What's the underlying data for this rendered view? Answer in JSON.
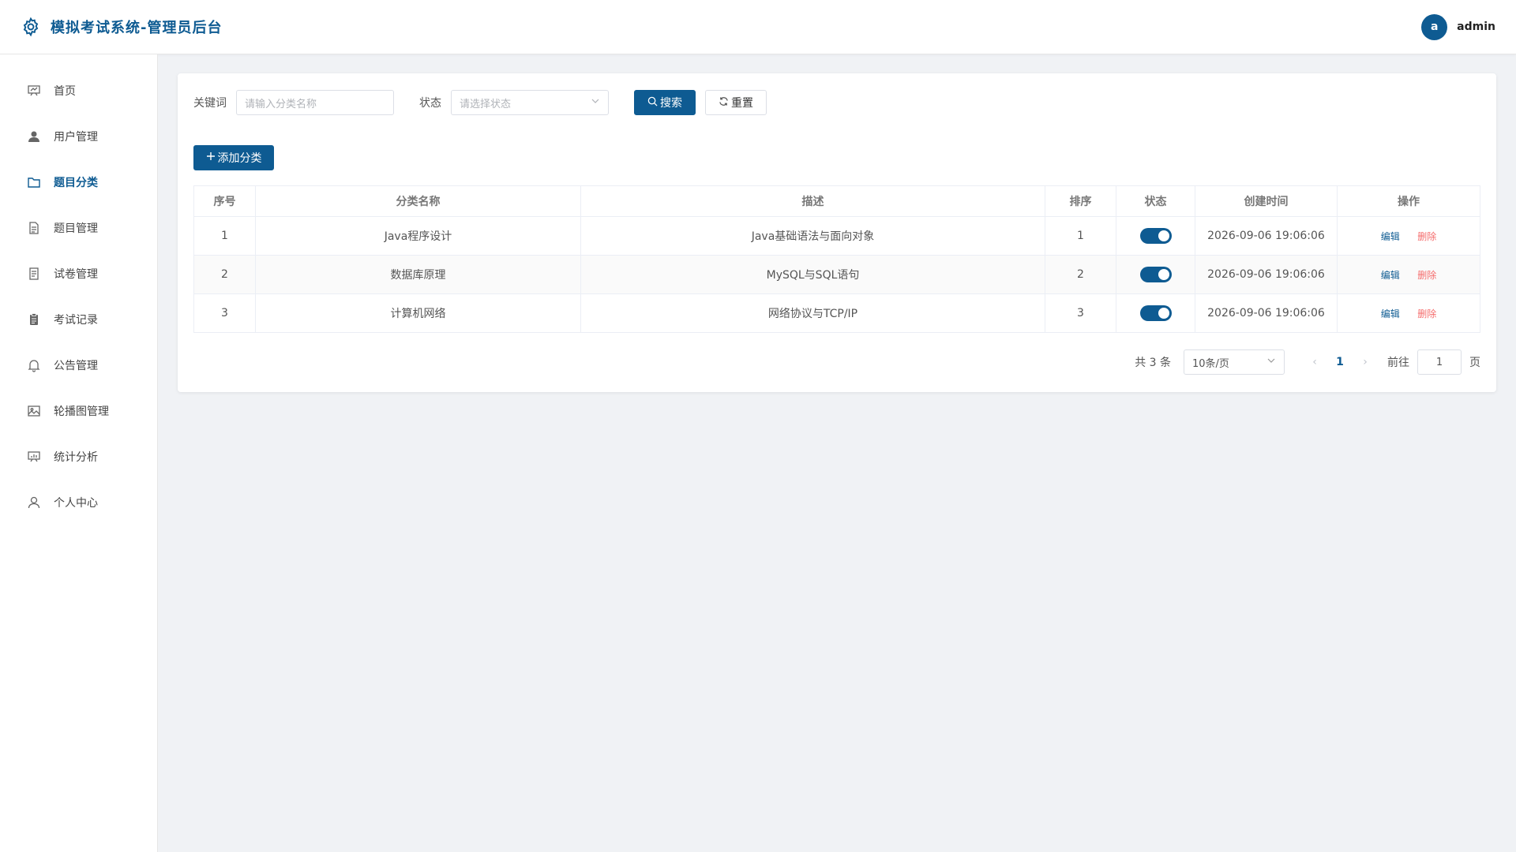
{
  "app": {
    "title": "模拟考试系统-管理员后台"
  },
  "user": {
    "avatar_letter": "a",
    "name": "admin"
  },
  "sidebar": {
    "items": [
      {
        "label": "首页",
        "icon": "dashboard-icon",
        "active": false
      },
      {
        "label": "用户管理",
        "icon": "user-icon",
        "active": false
      },
      {
        "label": "题目分类",
        "icon": "folder-icon",
        "active": true
      },
      {
        "label": "题目管理",
        "icon": "document-icon",
        "active": false
      },
      {
        "label": "试卷管理",
        "icon": "paper-icon",
        "active": false
      },
      {
        "label": "考试记录",
        "icon": "clipboard-icon",
        "active": false
      },
      {
        "label": "公告管理",
        "icon": "bell-icon",
        "active": false
      },
      {
        "label": "轮播图管理",
        "icon": "picture-icon",
        "active": false
      },
      {
        "label": "统计分析",
        "icon": "chart-icon",
        "active": false
      },
      {
        "label": "个人中心",
        "icon": "profile-icon",
        "active": false
      }
    ]
  },
  "search": {
    "keyword_label": "关键词",
    "keyword_placeholder": "请输入分类名称",
    "status_label": "状态",
    "status_placeholder": "请选择状态",
    "search_button": "搜索",
    "reset_button": "重置"
  },
  "actions": {
    "add_button": "添加分类"
  },
  "table": {
    "headers": [
      "序号",
      "分类名称",
      "描述",
      "排序",
      "状态",
      "创建时间",
      "操作"
    ],
    "rows": [
      {
        "no": "1",
        "name": "Java程序设计",
        "desc": "Java基础语法与面向对象",
        "sort": "1",
        "enabled": true,
        "created": "2026-09-06 19:06:06"
      },
      {
        "no": "2",
        "name": "数据库原理",
        "desc": "MySQL与SQL语句",
        "sort": "2",
        "enabled": true,
        "created": "2026-09-06 19:06:06"
      },
      {
        "no": "3",
        "name": "计算机网络",
        "desc": "网络协议与TCP/IP",
        "sort": "3",
        "enabled": true,
        "created": "2026-09-06 19:06:06"
      }
    ],
    "edit_label": "编辑",
    "delete_label": "删除"
  },
  "pagination": {
    "total_text": "共 3 条",
    "page_size": "10条/页",
    "current_page": "1",
    "goto_label": "前往",
    "goto_value": "1",
    "page_suffix": "页"
  },
  "colors": {
    "primary": "#0e5b92",
    "danger": "#f56c6c"
  }
}
